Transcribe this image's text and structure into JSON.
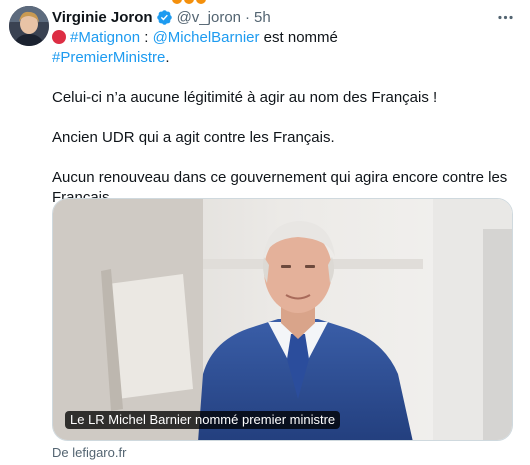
{
  "tweet": {
    "author_name": "Virginie Joron",
    "author_handle": "@v_joron",
    "separator": "·",
    "time": "5h",
    "emoji_circle": "red-circle",
    "hashtag_matignon": "#Matignon",
    "colon": " : ",
    "mention": "@MichelBarnier",
    "text_after_mention": " est nommé",
    "hashtag_pm": "#PremierMinistre",
    "text_after_hashtag": ".",
    "paragraph_2": "Celui-ci n’a aucune légitimité à agir au nom des Français !",
    "paragraph_3": "Ancien UDR qui a agit contre les Français.",
    "paragraph_4": "Aucun renouveau dans ce gouvernement qui agira encore contre les Français."
  },
  "card": {
    "caption": "Le LR Michel Barnier nommé premier ministre",
    "source": "De lefigaro.fr"
  },
  "colors": {
    "link": "#1d9bf0",
    "verified": "#1d9bf0",
    "text": "#0f1419",
    "secondary": "#536471"
  }
}
